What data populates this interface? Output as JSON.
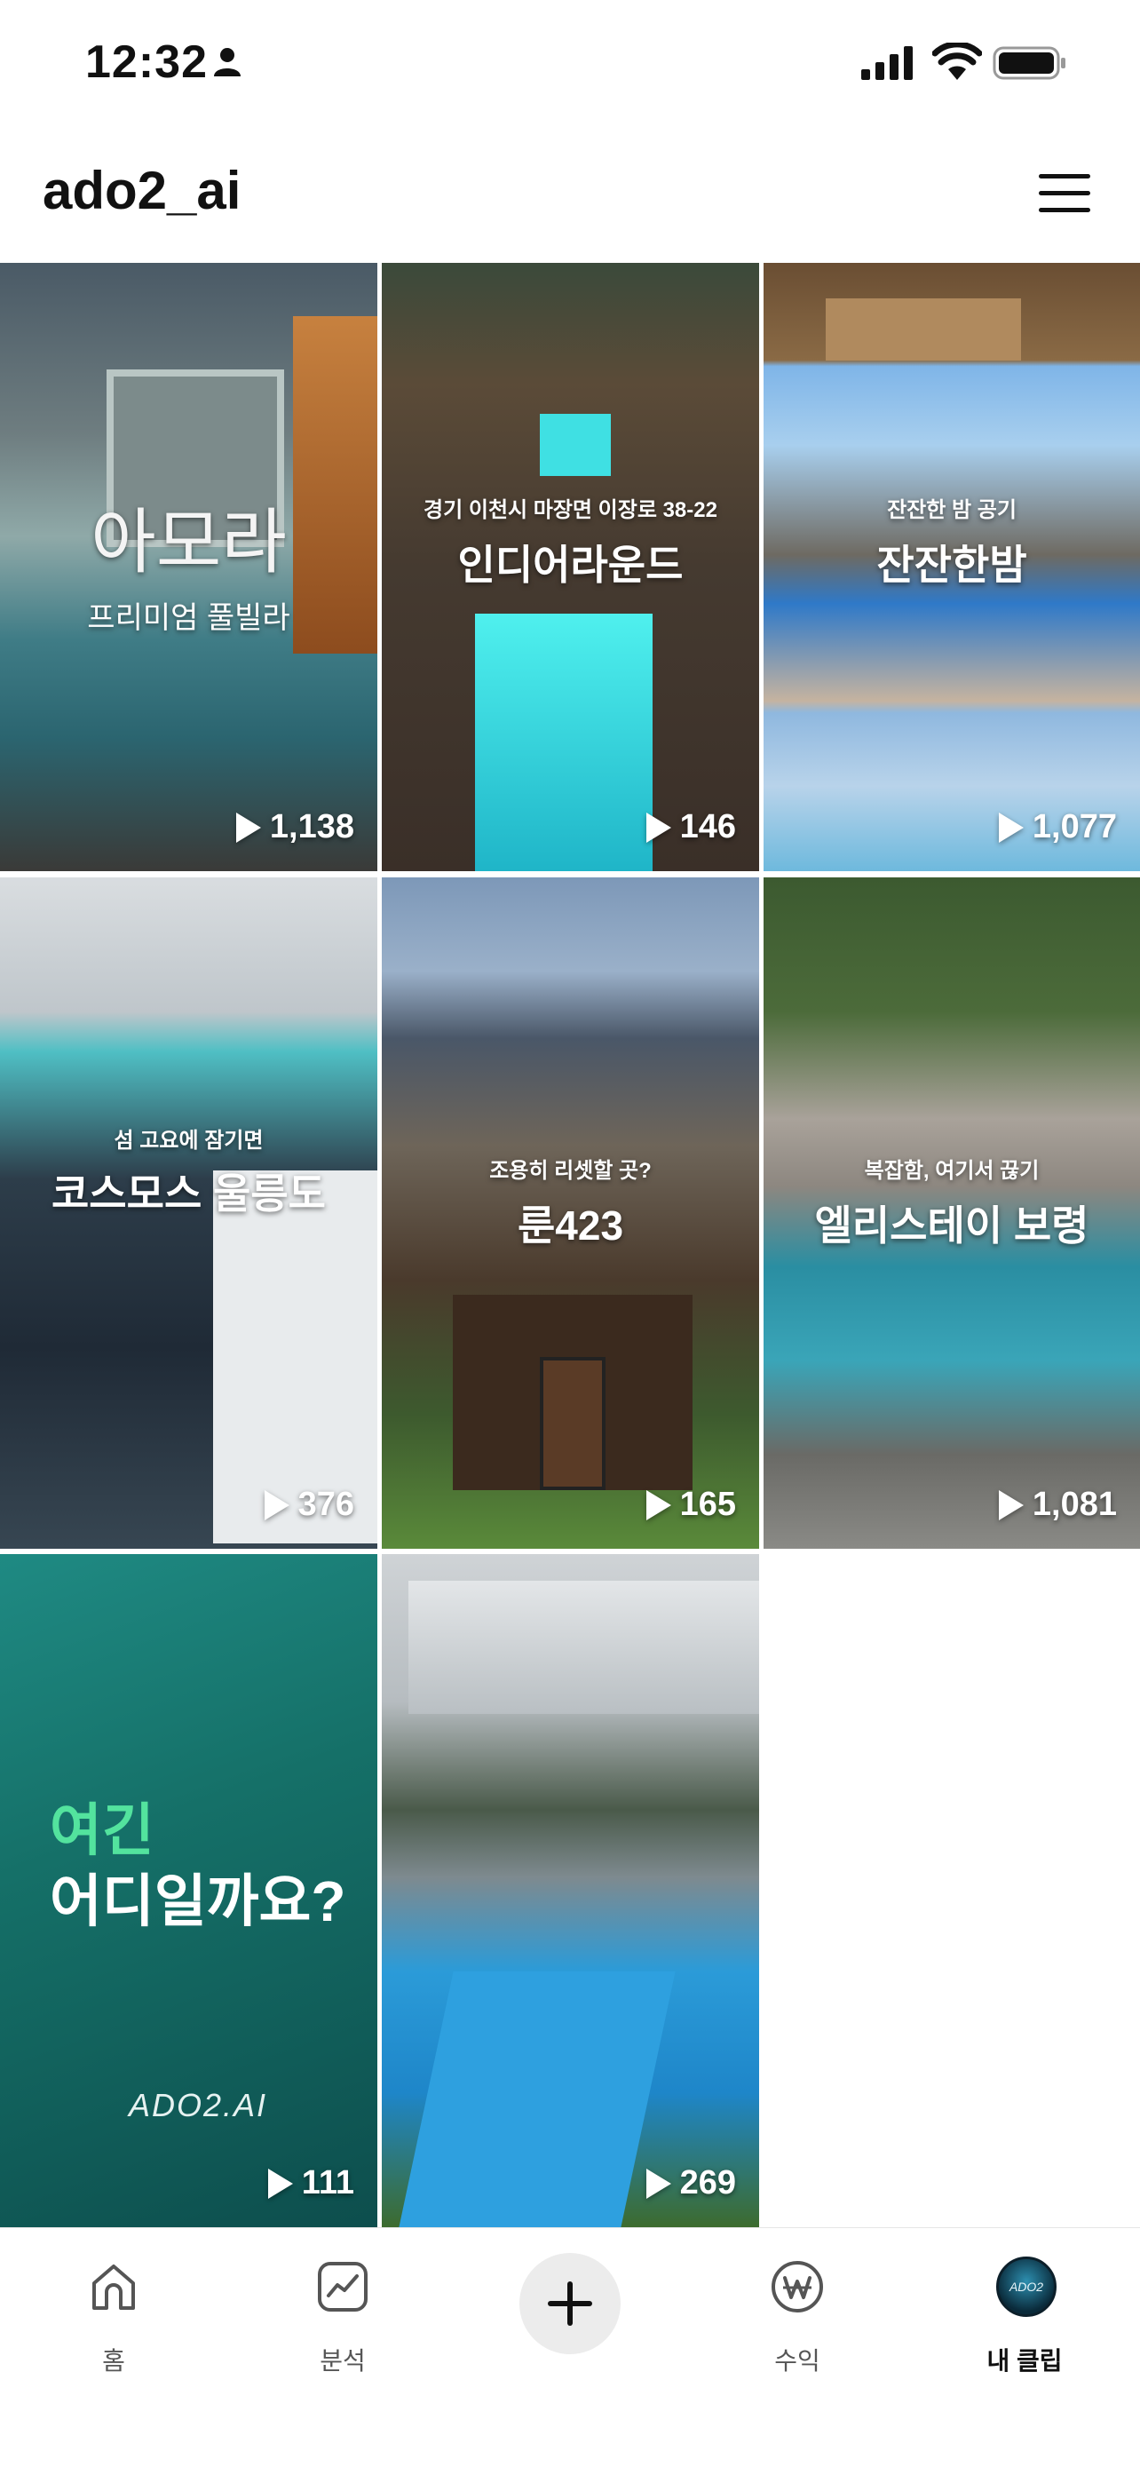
{
  "status_bar": {
    "time": "12:32"
  },
  "header": {
    "username": "ado2_ai"
  },
  "clips": [
    {
      "title": "아모라",
      "subtitle": "프리미엄 풀빌라",
      "views": "1,138"
    },
    {
      "title": "인디어라운드",
      "subtitle": "경기 이천시 마장면 이장로 38-22",
      "views": "146"
    },
    {
      "title": "잔잔한밤",
      "subtitle": "잔잔한 밤 공기",
      "views": "1,077"
    },
    {
      "title": "코스모스 울릉도",
      "subtitle": "섬 고요에 잠기면",
      "views": "376"
    },
    {
      "title": "룬423",
      "subtitle": "조용히 리셋할 곳?",
      "views": "165"
    },
    {
      "title": "엘리스테이 보령",
      "subtitle": "복잡함, 여기서 끊기",
      "views": "1,081"
    },
    {
      "line1": "여긴",
      "line2": "어디일까요?",
      "logo": "ADO2.AI",
      "views": "111"
    },
    {
      "views": "269"
    }
  ],
  "bottom_nav": {
    "home": "홈",
    "analytics": "분석",
    "revenue": "수익",
    "my_clips": "내 클립",
    "avatar_text": "ADO2"
  },
  "colors": {
    "accent_green": "#53e39e",
    "text_primary": "#111111",
    "nav_inactive": "#555555"
  }
}
